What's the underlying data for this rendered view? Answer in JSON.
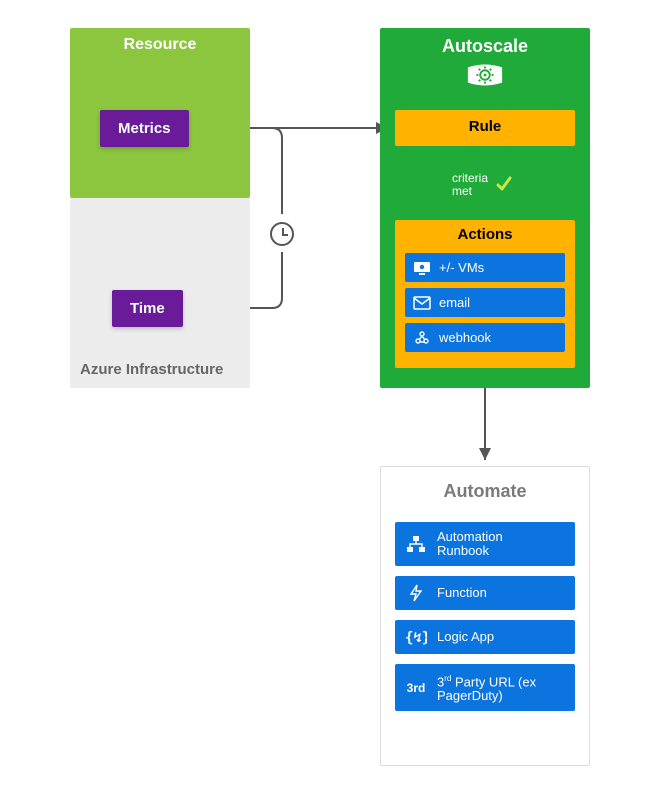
{
  "resource": {
    "title": "Resource",
    "metrics_label": "Metrics"
  },
  "azure_infra": {
    "title": "Azure Infrastructure",
    "time_label": "Time"
  },
  "autoscale": {
    "title": "Autoscale",
    "rule_label": "Rule",
    "criteria_label": "criteria\nmet",
    "actions_title": "Actions",
    "actions": [
      {
        "label": "+/- VMs",
        "icon": "vm-icon"
      },
      {
        "label": "email",
        "icon": "email-icon"
      },
      {
        "label": "webhook",
        "icon": "webhook-icon"
      }
    ]
  },
  "automate": {
    "title": "Automate",
    "items": [
      {
        "label": "Automation Runbook",
        "icon": "runbook-icon"
      },
      {
        "label": "Function",
        "icon": "function-icon"
      },
      {
        "label": "Logic App",
        "icon": "logic-app-icon"
      },
      {
        "label_html": "3<sup>rd</sup> Party URL (ex PagerDuty)",
        "icon_text": "3rd"
      }
    ]
  },
  "chart_data": {
    "type": "diagram",
    "nodes": [
      {
        "id": "resource",
        "label": "Resource",
        "children": [
          "metrics"
        ]
      },
      {
        "id": "metrics",
        "label": "Metrics"
      },
      {
        "id": "azure_infra",
        "label": "Azure Infrastructure",
        "children": [
          "time"
        ]
      },
      {
        "id": "time",
        "label": "Time"
      },
      {
        "id": "autoscale",
        "label": "Autoscale",
        "children": [
          "rule",
          "actions"
        ]
      },
      {
        "id": "rule",
        "label": "Rule"
      },
      {
        "id": "actions",
        "label": "Actions",
        "children": [
          "vms",
          "email",
          "webhook"
        ]
      },
      {
        "id": "vms",
        "label": "+/- VMs"
      },
      {
        "id": "email",
        "label": "email"
      },
      {
        "id": "webhook",
        "label": "webhook"
      },
      {
        "id": "automate",
        "label": "Automate",
        "children": [
          "runbook",
          "function",
          "logicapp",
          "thirdparty"
        ]
      },
      {
        "id": "runbook",
        "label": "Automation Runbook"
      },
      {
        "id": "function",
        "label": "Function"
      },
      {
        "id": "logicapp",
        "label": "Logic App"
      },
      {
        "id": "thirdparty",
        "label": "3rd Party URL (ex PagerDuty)"
      }
    ],
    "edges": [
      {
        "from": "metrics",
        "to": "rule"
      },
      {
        "from": "time",
        "to": "rule",
        "via": "clock"
      },
      {
        "from": "rule",
        "to": "actions",
        "label": "criteria met"
      },
      {
        "from": "webhook",
        "to": "automate"
      }
    ]
  }
}
